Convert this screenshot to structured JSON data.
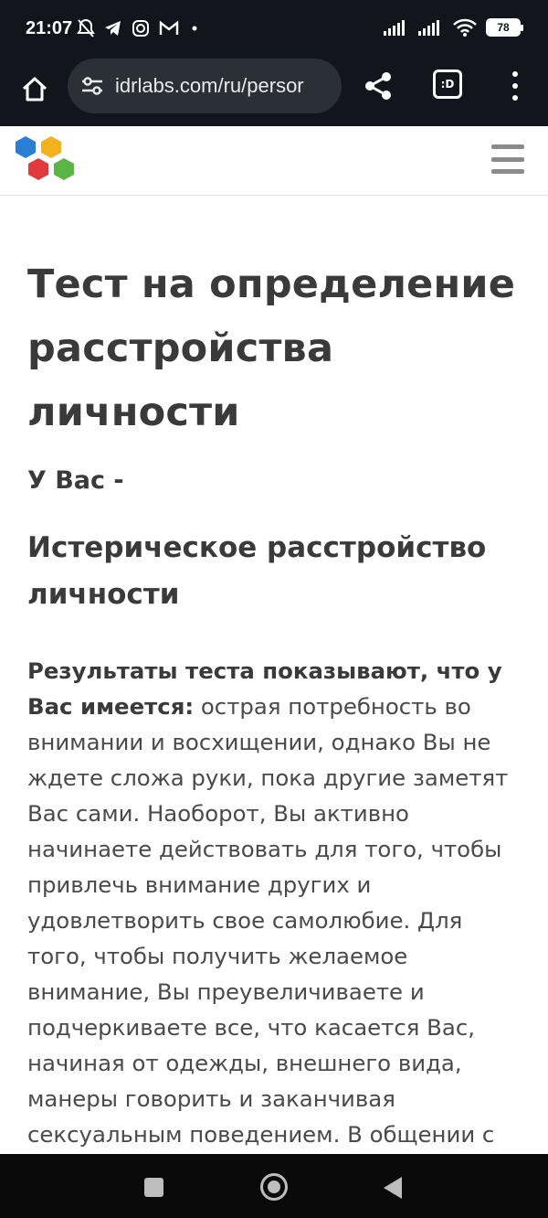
{
  "status_bar": {
    "time": "21:07",
    "battery": "78",
    "left_icons": [
      "bell-off-icon",
      "telegram-icon",
      "instagram-icon",
      "gmail-icon",
      "dot-icon"
    ],
    "right_icons": [
      "signal-icon",
      "signal-icon",
      "wifi-icon",
      "battery-icon"
    ]
  },
  "browser": {
    "url": "idrlabs.com/ru/persor",
    "tabs_label": ":D"
  },
  "page": {
    "title": "Тест на определение расстройства личности",
    "subtitle": "У Вас -",
    "result": "Истерическое расстройство личности",
    "para_lead": "Результаты теста показывают, что у Вас имеется:",
    "para_body": " острая потребность во внимании и восхищении, однако Вы не ждете сложа руки, пока другие заметят Вас сами. Наоборот, Вы активно начинаете действовать для того, чтобы привлечь внимание других и удовлетворить свое самолюбие. Для того, чтобы получить желаемое внимание, Вы преувеличиваете и подчеркиваете все, что касается Вас, начиная от одежды, внешнего вида, манеры говорить и заканчивая сексуальным поведением. В общении с новыми людьми Вы"
  },
  "colors": {
    "logo_blue": "#2a7fd4",
    "logo_yellow": "#f2b31c",
    "logo_red": "#e03a3e",
    "logo_green": "#5bb545"
  }
}
